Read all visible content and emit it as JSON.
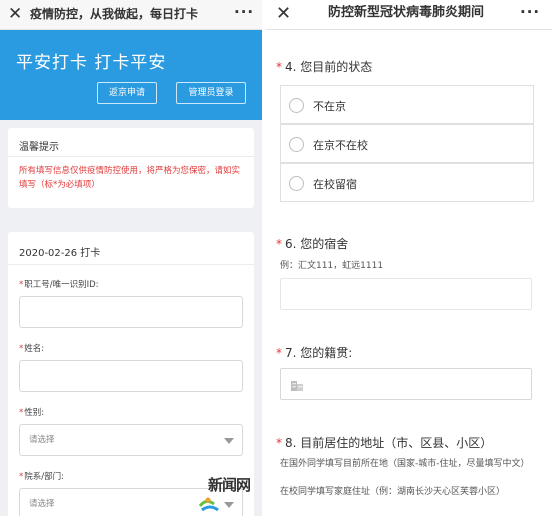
{
  "left": {
    "topbar": {
      "close": "✕",
      "title": "疫情防控，从我做起，每日打卡",
      "more": "···"
    },
    "banner": {
      "title": "平安打卡  打卡平安",
      "btn_apply": "返京申请",
      "btn_admin": "管理员登录"
    },
    "notice": {
      "title": "温馨提示",
      "text": "所有填写信息仅供疫情防控使用，将严格为您保密，请如实填写（标*为必填项）"
    },
    "form": {
      "date_title": "2020-02-26 打卡",
      "fields": [
        {
          "req": "*",
          "label": "职工号/唯一识别ID:"
        },
        {
          "req": "*",
          "label": "姓名:"
        },
        {
          "req": "*",
          "label": "性别:",
          "placeholder": "请选择"
        },
        {
          "req": "*",
          "label": "院系/部门:",
          "placeholder": "请选择"
        }
      ]
    },
    "watermark": "新闻网"
  },
  "right": {
    "topbar": {
      "close": "✕",
      "title": "防控新型冠状病毒肺炎期间",
      "more": "···"
    },
    "questions": {
      "q4": {
        "star": "*",
        "title": "4. 您目前的状态",
        "options": [
          "不在京",
          "在京不在校",
          "在校留宿"
        ]
      },
      "q6": {
        "star": "*",
        "title": "6. 您的宿舍",
        "hint": "例：汇文111，虹远1111"
      },
      "q7": {
        "star": "*",
        "title": "7. 您的籍贯:"
      },
      "q8": {
        "star": "*",
        "title": "8. 目前居住的地址（市、区县、小区）",
        "hint1": "在国外同学填写目前所在地（国家-城市-住址，尽量填写中文）",
        "hint2": "在校同学填写家庭住址（例：湖南长沙天心区芙蓉小区）"
      }
    }
  },
  "colors": {
    "brand_blue": "#2a9be0",
    "required_red": "#e23a3a"
  }
}
